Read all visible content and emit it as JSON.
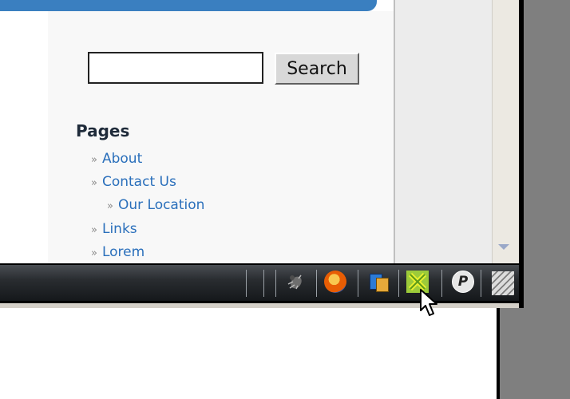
{
  "search": {
    "placeholder": "",
    "button_label": "Search"
  },
  "pages": {
    "heading": "Pages",
    "bullet": "»",
    "items": [
      {
        "label": "About",
        "level": 1
      },
      {
        "label": "Contact Us",
        "level": 1
      },
      {
        "label": "Our Location",
        "level": 2
      },
      {
        "label": "Links",
        "level": 1
      },
      {
        "label": "Lorem",
        "level": 1
      }
    ]
  },
  "tray": {
    "p_icon_letter": "P",
    "icons": [
      "bug-icon",
      "firefox-icon",
      "app-icon",
      "cross-icon",
      "p-icon"
    ]
  },
  "colors": {
    "header_blue": "#3a7fc0",
    "link": "#2a6fbb",
    "taskbar": "#2a2d31"
  }
}
